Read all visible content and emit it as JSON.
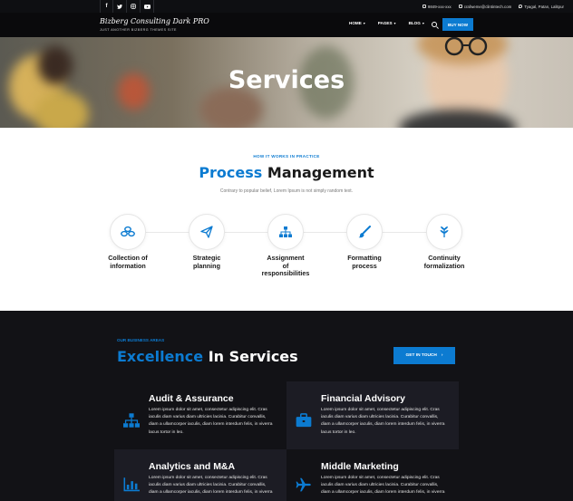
{
  "topbar": {
    "social": [
      "f",
      "t",
      "ig",
      "yt"
    ],
    "phone": "9849-xxx-xxx",
    "email": "crafweme@clintintech.com",
    "address": "Tyagal, Patan, Lalitpur"
  },
  "header": {
    "logo": "Bizberg Consulting Dark PRO",
    "tagline": "JUST ANOTHER BIZBERG THEMES SITE",
    "nav": [
      {
        "label": "HOME"
      },
      {
        "label": "PAGES"
      },
      {
        "label": "BLOG"
      }
    ],
    "buy_label": "BUY NOW"
  },
  "hero": {
    "title": "Services"
  },
  "process": {
    "eyebrow": "HOW IT WORKS IN PRACTICE",
    "title_blue": "Process",
    "title_dark": "Management",
    "subtitle": "Contrary to popular belief, Lorem Ipsum is not simply random text.",
    "steps": [
      {
        "l1": "Collection of",
        "l2": "information",
        "l3": "",
        "icon": "coins-icon"
      },
      {
        "l1": "Strategic",
        "l2": "planning",
        "l3": "",
        "icon": "paper-plane-icon"
      },
      {
        "l1": "Assignment",
        "l2": "of",
        "l3": "responsibilities",
        "icon": "sitemap-icon"
      },
      {
        "l1": "Formatting",
        "l2": "process",
        "l3": "",
        "icon": "brush-icon"
      },
      {
        "l1": "Continuity",
        "l2": "formalization",
        "l3": "",
        "icon": "leaf-icon"
      }
    ]
  },
  "business": {
    "eyebrow": "OUR BUSINESS AREAS",
    "title_blue": "Excellence",
    "title_white": "In Services",
    "cta": "GET IN TOUCH",
    "cards": [
      {
        "title": "Audit & Assurance",
        "l1": "Lorem ipsum dolor sit amet, consectetur adipiscing elit. Cras",
        "l2": "iaculis diam varius diam ultricies lacinia. Curabitur convallis,",
        "l3": "diam a ullamcorper iaculis, diam lorem interdum felis, in viverra",
        "l4": "lacus tortor in leo.",
        "icon": "sitemap-icon"
      },
      {
        "title": "Financial Advisory",
        "l1": "Lorem ipsum dolor sit amet, consectetur adipiscing elit. Cras",
        "l2": "iaculis diam varius diam ultricies lacinia. Curabitur convallis,",
        "l3": "diam a ullamcorper iaculis, diam lorem interdum felis, in viverra",
        "l4": "lacus tortor in leo.",
        "icon": "briefcase-icon"
      },
      {
        "title": "Analytics and M&A",
        "l1": "Lorem ipsum dolor sit amet, consectetur adipiscing elit. Cras",
        "l2": "iaculis diam varius diam ultricies lacinia. Curabitur convallis,",
        "l3": "diam a ullamcorper iaculis, diam lorem interdum felis, in viverra",
        "l4": "",
        "icon": "chart-icon"
      },
      {
        "title": "Middle Marketing",
        "l1": "Lorem ipsum dolor sit amet, consectetur adipiscing elit. Cras",
        "l2": "iaculis diam varius diam ultricies lacinia. Curabitur convallis,",
        "l3": "diam a ullamcorper iaculis, diam lorem interdum felis, in viverra",
        "l4": "",
        "icon": "plane-icon"
      }
    ]
  },
  "colors": {
    "accent": "#0c7bd1",
    "dark": "#121216",
    "card_alt": "#1c1c24"
  }
}
